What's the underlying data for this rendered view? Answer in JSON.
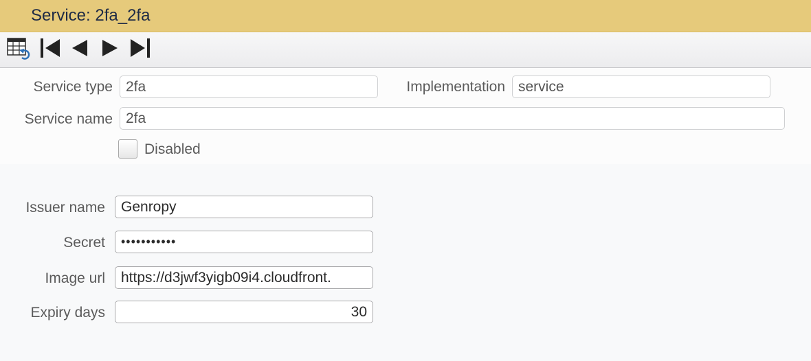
{
  "window": {
    "title": "Service: 2fa_2fa"
  },
  "toolbar": {
    "buttons": [
      {
        "icon": "table-view-icon"
      },
      {
        "icon": "first-record-icon"
      },
      {
        "icon": "previous-record-icon"
      },
      {
        "icon": "next-record-icon"
      },
      {
        "icon": "last-record-icon"
      }
    ]
  },
  "form": {
    "service_type": {
      "label": "Service type",
      "value": "2fa"
    },
    "implementation": {
      "label": "Implementation",
      "value": "service"
    },
    "service_name": {
      "label": "Service name",
      "value": "2fa"
    },
    "disabled": {
      "label": "Disabled",
      "checked": false
    }
  },
  "params": {
    "issuer_name": {
      "label": "Issuer name",
      "value": "Genropy"
    },
    "secret": {
      "label": "Secret",
      "value": "•••••••••••"
    },
    "image_url": {
      "label": "Image url",
      "value": "https://d3jwf3yigb09i4.cloudfront."
    },
    "expiry_days": {
      "label": "Expiry days",
      "value": "30"
    }
  },
  "colors": {
    "title_bar": "#e6ca7b",
    "title_text": "#1e2a45",
    "icon_dark": "#222222",
    "icon_blue": "#2b6fb6"
  }
}
